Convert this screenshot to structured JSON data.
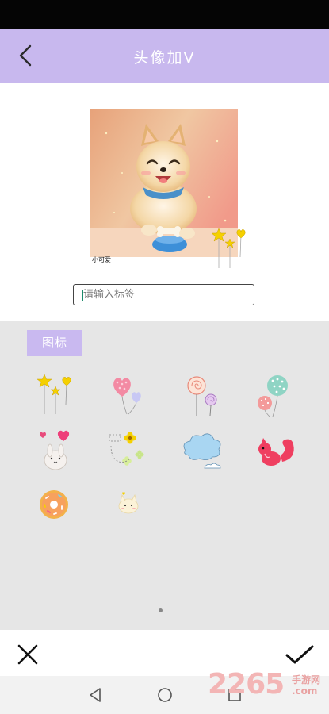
{
  "header": {
    "title": "头像加V"
  },
  "preview": {
    "caption": "小可爱"
  },
  "tag_input": {
    "placeholder": "请输入标签",
    "value": ""
  },
  "panel": {
    "tab_label": "图标"
  },
  "stickers": [
    "stars-heart-balloons",
    "pink-heart-balloons",
    "lollipops",
    "polka-dot-balloons",
    "bunny-hearts",
    "flower-doodle",
    "blue-cloud",
    "red-squirrel",
    "donut",
    "kitty-heart"
  ],
  "watermark": {
    "number": "2265",
    "site_cn": "手游网",
    "site": ".com"
  },
  "colors": {
    "accent": "#c8b8ee",
    "tab": "#c9b9f0",
    "panel_bg": "#e6e6e6"
  }
}
